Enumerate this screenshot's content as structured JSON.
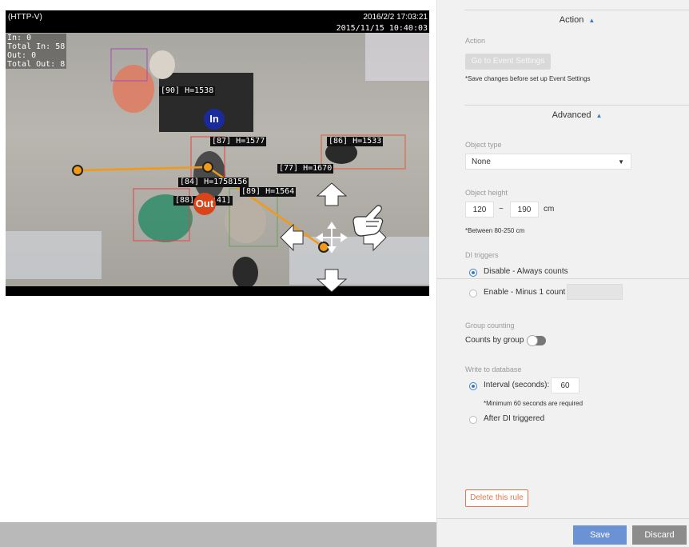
{
  "video": {
    "stream_label": "(HTTP-V)",
    "date_time_1": "2016/2/2 17:03:21",
    "date_time_2": "2015/11/15 10:40:03",
    "counters": [
      "In: 0",
      "Total In: 58",
      "Out: 0",
      "Total Out: 8"
    ],
    "object_labels": [
      "[90] H=1538",
      "[87] H=1577",
      "[86] H=1533",
      "[77] H=1670",
      "[84] H=1758156",
      "[89] H=1564",
      "[88] H=",
      "41]"
    ],
    "in_badge": "In",
    "out_badge": "Out",
    "colors": {
      "in_badge": "#1a2a9c",
      "out_badge": "#d8451a",
      "counting_line": "#f09a18"
    }
  },
  "panel": {
    "action_section": {
      "title": "Action",
      "label": "Action",
      "button": "Go to Event Settings",
      "note": "*Save changes before set up Event Settings"
    },
    "advanced_section": {
      "title": "Advanced"
    },
    "object_type": {
      "label": "Object type",
      "value": "None"
    },
    "object_height": {
      "label": "Object height",
      "min": "120",
      "separator": "~",
      "max": "190",
      "unit": "cm",
      "note": "*Between 80-250 cm"
    },
    "di_triggers": {
      "label": "DI triggers",
      "option_disable": "Disable - Always counts",
      "option_enable": "Enable - Minus 1 count",
      "enable_value": ""
    },
    "group_counting": {
      "label": "Group counting",
      "toggle_label": "Counts by group",
      "enabled": false
    },
    "write_db": {
      "label": "Write to database",
      "option_interval": "Interval (seconds):",
      "interval_value": "60",
      "note": "*Minimum 60 seconds are required",
      "option_after_di": "After DI triggered"
    },
    "delete_button": "Delete this rule",
    "save_button": "Save",
    "discard_button": "Discard",
    "colors": {
      "accent": "#3b79c9",
      "save": "#6a92d4",
      "discard": "#8c8c8c",
      "delete": "#e0764e"
    }
  }
}
